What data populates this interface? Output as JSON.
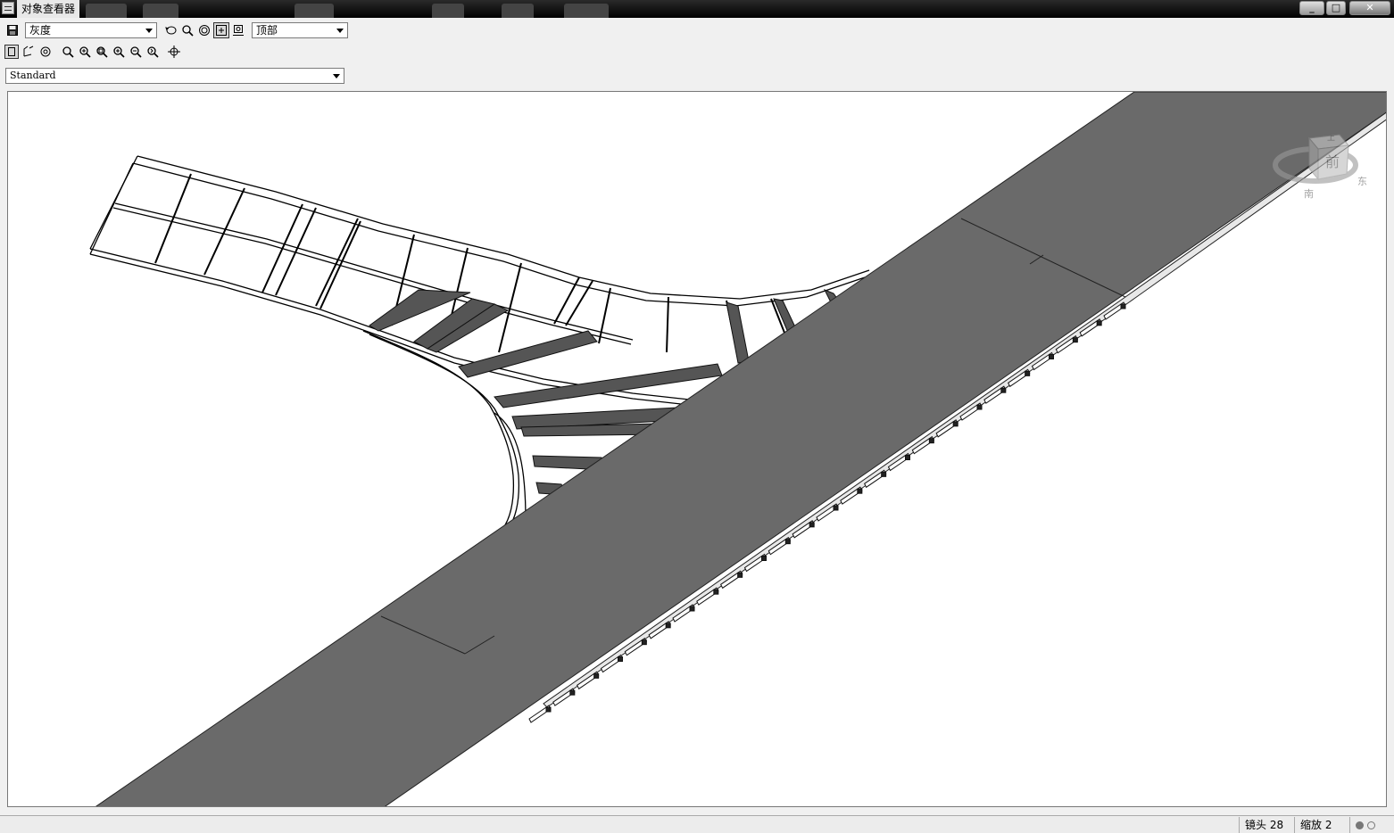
{
  "window": {
    "title": "对象查看器",
    "minimize_icon": "minimize-icon",
    "maximize_icon": "maximize-icon",
    "close_icon": "close-icon"
  },
  "toolbar1": {
    "save_icon": "save-icon",
    "visual_style": "灰度",
    "view_direction": "顶部",
    "tools": [
      "orbit-icon",
      "zoom-realtime-icon",
      "zoom-window-icon",
      "pan-icon",
      "view-box-icon"
    ]
  },
  "toolbar2": {
    "tools": [
      "view-cube-icon",
      "ucs-icon",
      "steering-wheel-icon",
      "zoom-icon",
      "zoom-in-icon",
      "zoom-all-icon",
      "zoom-extents-icon",
      "zoom-out-icon",
      "zoom-previous-icon",
      "pan-cross-icon"
    ]
  },
  "style_selector": {
    "value": "Standard"
  },
  "viewcube": {
    "top_label": "上",
    "face_label": "前",
    "left_label": "南",
    "right_label": "东"
  },
  "status": {
    "lens_label": "镜头 28",
    "zoom_label": "缩放 2"
  }
}
